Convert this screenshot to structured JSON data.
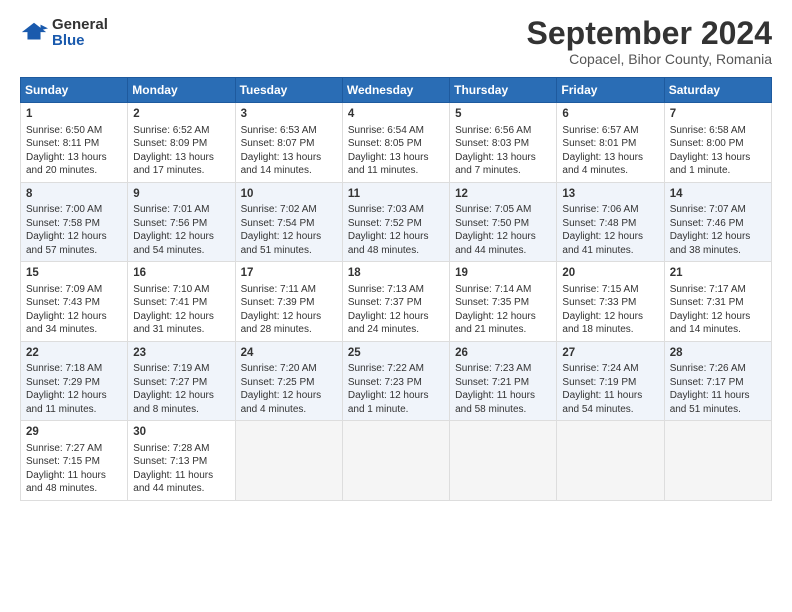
{
  "header": {
    "logo_line1": "General",
    "logo_line2": "Blue",
    "month_title": "September 2024",
    "subtitle": "Copacel, Bihor County, Romania"
  },
  "weekdays": [
    "Sunday",
    "Monday",
    "Tuesday",
    "Wednesday",
    "Thursday",
    "Friday",
    "Saturday"
  ],
  "weeks": [
    [
      {
        "day": "1",
        "lines": [
          "Sunrise: 6:50 AM",
          "Sunset: 8:11 PM",
          "Daylight: 13 hours",
          "and 20 minutes."
        ]
      },
      {
        "day": "2",
        "lines": [
          "Sunrise: 6:52 AM",
          "Sunset: 8:09 PM",
          "Daylight: 13 hours",
          "and 17 minutes."
        ]
      },
      {
        "day": "3",
        "lines": [
          "Sunrise: 6:53 AM",
          "Sunset: 8:07 PM",
          "Daylight: 13 hours",
          "and 14 minutes."
        ]
      },
      {
        "day": "4",
        "lines": [
          "Sunrise: 6:54 AM",
          "Sunset: 8:05 PM",
          "Daylight: 13 hours",
          "and 11 minutes."
        ]
      },
      {
        "day": "5",
        "lines": [
          "Sunrise: 6:56 AM",
          "Sunset: 8:03 PM",
          "Daylight: 13 hours",
          "and 7 minutes."
        ]
      },
      {
        "day": "6",
        "lines": [
          "Sunrise: 6:57 AM",
          "Sunset: 8:01 PM",
          "Daylight: 13 hours",
          "and 4 minutes."
        ]
      },
      {
        "day": "7",
        "lines": [
          "Sunrise: 6:58 AM",
          "Sunset: 8:00 PM",
          "Daylight: 13 hours",
          "and 1 minute."
        ]
      }
    ],
    [
      {
        "day": "8",
        "lines": [
          "Sunrise: 7:00 AM",
          "Sunset: 7:58 PM",
          "Daylight: 12 hours",
          "and 57 minutes."
        ]
      },
      {
        "day": "9",
        "lines": [
          "Sunrise: 7:01 AM",
          "Sunset: 7:56 PM",
          "Daylight: 12 hours",
          "and 54 minutes."
        ]
      },
      {
        "day": "10",
        "lines": [
          "Sunrise: 7:02 AM",
          "Sunset: 7:54 PM",
          "Daylight: 12 hours",
          "and 51 minutes."
        ]
      },
      {
        "day": "11",
        "lines": [
          "Sunrise: 7:03 AM",
          "Sunset: 7:52 PM",
          "Daylight: 12 hours",
          "and 48 minutes."
        ]
      },
      {
        "day": "12",
        "lines": [
          "Sunrise: 7:05 AM",
          "Sunset: 7:50 PM",
          "Daylight: 12 hours",
          "and 44 minutes."
        ]
      },
      {
        "day": "13",
        "lines": [
          "Sunrise: 7:06 AM",
          "Sunset: 7:48 PM",
          "Daylight: 12 hours",
          "and 41 minutes."
        ]
      },
      {
        "day": "14",
        "lines": [
          "Sunrise: 7:07 AM",
          "Sunset: 7:46 PM",
          "Daylight: 12 hours",
          "and 38 minutes."
        ]
      }
    ],
    [
      {
        "day": "15",
        "lines": [
          "Sunrise: 7:09 AM",
          "Sunset: 7:43 PM",
          "Daylight: 12 hours",
          "and 34 minutes."
        ]
      },
      {
        "day": "16",
        "lines": [
          "Sunrise: 7:10 AM",
          "Sunset: 7:41 PM",
          "Daylight: 12 hours",
          "and 31 minutes."
        ]
      },
      {
        "day": "17",
        "lines": [
          "Sunrise: 7:11 AM",
          "Sunset: 7:39 PM",
          "Daylight: 12 hours",
          "and 28 minutes."
        ]
      },
      {
        "day": "18",
        "lines": [
          "Sunrise: 7:13 AM",
          "Sunset: 7:37 PM",
          "Daylight: 12 hours",
          "and 24 minutes."
        ]
      },
      {
        "day": "19",
        "lines": [
          "Sunrise: 7:14 AM",
          "Sunset: 7:35 PM",
          "Daylight: 12 hours",
          "and 21 minutes."
        ]
      },
      {
        "day": "20",
        "lines": [
          "Sunrise: 7:15 AM",
          "Sunset: 7:33 PM",
          "Daylight: 12 hours",
          "and 18 minutes."
        ]
      },
      {
        "day": "21",
        "lines": [
          "Sunrise: 7:17 AM",
          "Sunset: 7:31 PM",
          "Daylight: 12 hours",
          "and 14 minutes."
        ]
      }
    ],
    [
      {
        "day": "22",
        "lines": [
          "Sunrise: 7:18 AM",
          "Sunset: 7:29 PM",
          "Daylight: 12 hours",
          "and 11 minutes."
        ]
      },
      {
        "day": "23",
        "lines": [
          "Sunrise: 7:19 AM",
          "Sunset: 7:27 PM",
          "Daylight: 12 hours",
          "and 8 minutes."
        ]
      },
      {
        "day": "24",
        "lines": [
          "Sunrise: 7:20 AM",
          "Sunset: 7:25 PM",
          "Daylight: 12 hours",
          "and 4 minutes."
        ]
      },
      {
        "day": "25",
        "lines": [
          "Sunrise: 7:22 AM",
          "Sunset: 7:23 PM",
          "Daylight: 12 hours",
          "and 1 minute."
        ]
      },
      {
        "day": "26",
        "lines": [
          "Sunrise: 7:23 AM",
          "Sunset: 7:21 PM",
          "Daylight: 11 hours",
          "and 58 minutes."
        ]
      },
      {
        "day": "27",
        "lines": [
          "Sunrise: 7:24 AM",
          "Sunset: 7:19 PM",
          "Daylight: 11 hours",
          "and 54 minutes."
        ]
      },
      {
        "day": "28",
        "lines": [
          "Sunrise: 7:26 AM",
          "Sunset: 7:17 PM",
          "Daylight: 11 hours",
          "and 51 minutes."
        ]
      }
    ],
    [
      {
        "day": "29",
        "lines": [
          "Sunrise: 7:27 AM",
          "Sunset: 7:15 PM",
          "Daylight: 11 hours",
          "and 48 minutes."
        ]
      },
      {
        "day": "30",
        "lines": [
          "Sunrise: 7:28 AM",
          "Sunset: 7:13 PM",
          "Daylight: 11 hours",
          "and 44 minutes."
        ]
      },
      {
        "day": "",
        "lines": []
      },
      {
        "day": "",
        "lines": []
      },
      {
        "day": "",
        "lines": []
      },
      {
        "day": "",
        "lines": []
      },
      {
        "day": "",
        "lines": []
      }
    ]
  ]
}
